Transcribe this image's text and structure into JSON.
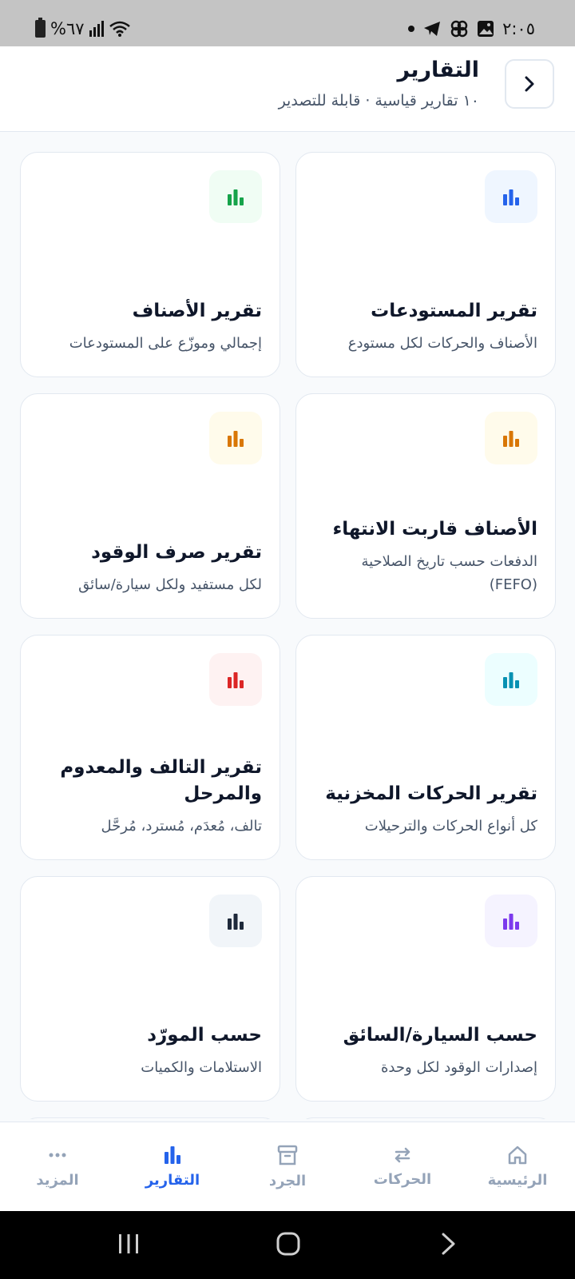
{
  "status_bar": {
    "time": "٢:٠٥",
    "battery_percent": "%٦٧",
    "icons": [
      "battery-icon",
      "signal-icon",
      "wifi-icon",
      "telegram-icon",
      "pinwheel-icon",
      "gallery-icon"
    ]
  },
  "header": {
    "title": "التقارير",
    "subtitle": "١٠ تقارير قياسية · قابلة للتصدير"
  },
  "reports": [
    {
      "title": "تقرير المستودعات",
      "description": "الأصناف والحركات لكل مستودع",
      "icon": "bar-chart-icon",
      "color": "#2563eb",
      "bg": "#eff6ff"
    },
    {
      "title": "تقرير الأصناف",
      "description": "إجمالي وموزّع على المستودعات",
      "icon": "bar-chart-icon",
      "color": "#16a34a",
      "bg": "#f0fdf4"
    },
    {
      "title": "الأصناف قاربت الانتهاء",
      "description": "الدفعات حسب تاريخ الصلاحية (FEFO)",
      "icon": "bar-chart-icon",
      "color": "#d97706",
      "bg": "#fffbeb"
    },
    {
      "title": "تقرير صرف الوقود",
      "description": "لكل مستفيد ولكل سيارة/سائق",
      "icon": "bar-chart-icon",
      "color": "#d97706",
      "bg": "#fffbeb"
    },
    {
      "title": "تقرير الحركات المخزنية",
      "description": "كل أنواع الحركات والترحيلات",
      "icon": "bar-chart-icon",
      "color": "#0891b2",
      "bg": "#ecfeff"
    },
    {
      "title": "تقرير التالف والمعدوم والمرحل",
      "description": "تالف، مُعدَم، مُسترد، مُرحَّل",
      "icon": "bar-chart-icon",
      "color": "#dc2626",
      "bg": "#fef2f2"
    },
    {
      "title": "حسب السيارة/السائق",
      "description": "إصدارات الوقود لكل وحدة",
      "icon": "bar-chart-icon",
      "color": "#7c3aed",
      "bg": "#f5f3ff"
    },
    {
      "title": "حسب المورّد",
      "description": "الاستلامات والكميات",
      "icon": "bar-chart-icon",
      "color": "#1e293b",
      "bg": "#f1f5f9"
    }
  ],
  "bottom_nav": {
    "home": "الرئيسية",
    "movements": "الحركات",
    "inventory": "الجرد",
    "reports": "التقارير",
    "more": "المزيد",
    "active": "reports"
  },
  "colors": {
    "accent": "#2563eb",
    "inactive": "#94a3b8"
  }
}
